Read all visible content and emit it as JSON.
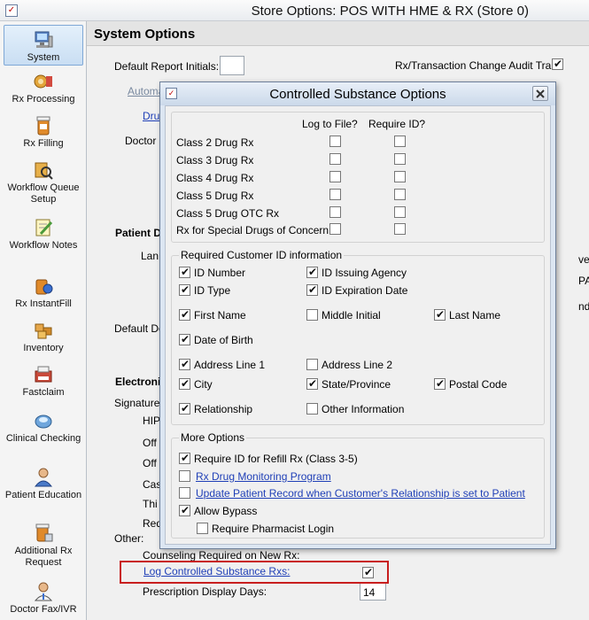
{
  "window": {
    "title": "Store Options: POS WITH HME & RX (Store 0)"
  },
  "sidebar": {
    "items": [
      {
        "label": "System",
        "icon": "computer-icon"
      },
      {
        "label": "Rx Processing",
        "icon": "rx-processing-icon"
      },
      {
        "label": "Rx Filling",
        "icon": "rx-filling-icon"
      },
      {
        "label": "Workflow Queue Setup",
        "icon": "workflow-queue-icon"
      },
      {
        "label": "Workflow Notes",
        "icon": "workflow-notes-icon"
      },
      {
        "label": "Rx InstantFill",
        "icon": "instantfill-icon"
      },
      {
        "label": "Inventory",
        "icon": "inventory-icon"
      },
      {
        "label": "Fastclaim",
        "icon": "fastclaim-icon"
      },
      {
        "label": "Clinical Checking",
        "icon": "clinical-checking-icon"
      },
      {
        "label": "Patient Education",
        "icon": "patient-education-icon"
      },
      {
        "label": "Additional Rx Request",
        "icon": "additional-rx-icon"
      },
      {
        "label": "Doctor Fax/IVR",
        "icon": "doctor-fax-icon"
      }
    ]
  },
  "main": {
    "header": "System Options",
    "default_report_initials": "Default Report Initials:",
    "audit_trail": "Rx/Transaction Change Audit Trail:",
    "partial_texts": [
      "Automa",
      "Drug",
      "Doctor I",
      "Patient D",
      "Lan",
      "Default De",
      "Electroni",
      "Signature",
      "HIP",
      "Off",
      "Off",
      "Cas",
      "Thi",
      "Req",
      "Other:",
      "Counseling Required on New Rx:",
      "ver",
      "PA",
      "nde"
    ],
    "log_controlled": "Log Controlled Substance Rxs:",
    "prescription_display_days": "Prescription Display Days:",
    "prescription_display_days_value": "14"
  },
  "dialog": {
    "title": "Controlled Substance Options",
    "col_log": "Log to File?",
    "col_require": "Require ID?",
    "drug_rows": [
      {
        "label": "Class 2 Drug Rx"
      },
      {
        "label": "Class 3 Drug Rx"
      },
      {
        "label": "Class 4 Drug Rx"
      },
      {
        "label": "Class 5 Drug Rx"
      },
      {
        "label": "Class 5 Drug OTC Rx"
      },
      {
        "label": "Rx for Special Drugs of Concern"
      }
    ],
    "required_group_title": "Required Customer ID information",
    "required": {
      "id_number": "ID Number",
      "id_issuing_agency": "ID Issuing Agency",
      "id_type": "ID Type",
      "id_expiration_date": "ID Expiration Date",
      "first_name": "First Name",
      "middle_initial": "Middle Initial",
      "last_name": "Last Name",
      "date_of_birth": "Date of Birth",
      "address_line_1": "Address Line 1",
      "address_line_2": "Address Line 2",
      "city": "City",
      "state_province": "State/Province",
      "postal_code": "Postal Code",
      "relationship": "Relationship",
      "other_information": "Other Information"
    },
    "more_group_title": "More Options",
    "more": {
      "require_id_refill": "Require ID for Refill Rx (Class 3-5)",
      "rx_drug_monitoring": "Rx Drug Monitoring Program",
      "update_patient_record": "Update Patient Record when Customer's Relationship is set to Patient",
      "allow_bypass": "Allow Bypass",
      "require_pharmacist_login": "Require Pharmacist Login"
    }
  }
}
